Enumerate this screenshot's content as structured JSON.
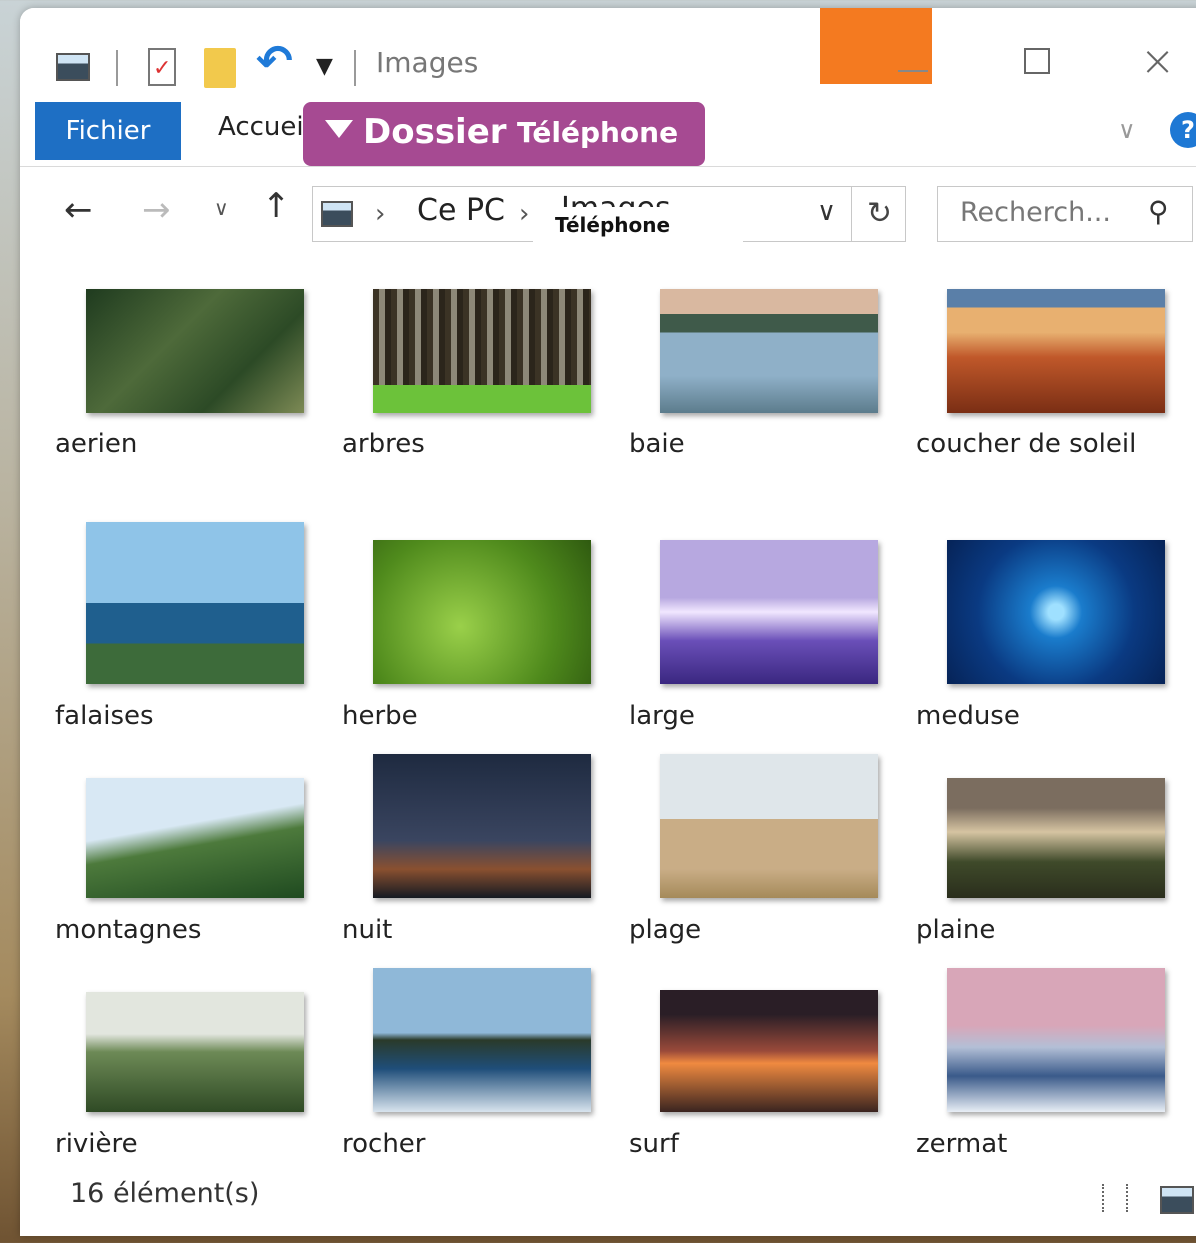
{
  "window": {
    "title": "Images",
    "caption_buttons": {
      "minimize": "minimize",
      "maximize": "maximize",
      "close": "close"
    }
  },
  "ribbon": {
    "tabs": [
      {
        "label": "Fichier"
      },
      {
        "label": "Accuei"
      }
    ],
    "highlight": {
      "label1": "Dossier",
      "label2": "Téléphone"
    }
  },
  "address": {
    "crumbs": [
      "Ce PC",
      "Images"
    ],
    "overlay": "Téléphone",
    "search_placeholder": "Recherch..."
  },
  "files": [
    {
      "name": "aerien"
    },
    {
      "name": "arbres"
    },
    {
      "name": "baie"
    },
    {
      "name": "coucher de soleil"
    },
    {
      "name": "falaises"
    },
    {
      "name": "herbe"
    },
    {
      "name": "large"
    },
    {
      "name": "meduse"
    },
    {
      "name": "montagnes"
    },
    {
      "name": "nuit"
    },
    {
      "name": "plage"
    },
    {
      "name": "plaine"
    },
    {
      "name": "rivière"
    },
    {
      "name": "rocher"
    },
    {
      "name": "surf"
    },
    {
      "name": "zermat"
    }
  ],
  "status": {
    "count": "16 élément(s)"
  }
}
